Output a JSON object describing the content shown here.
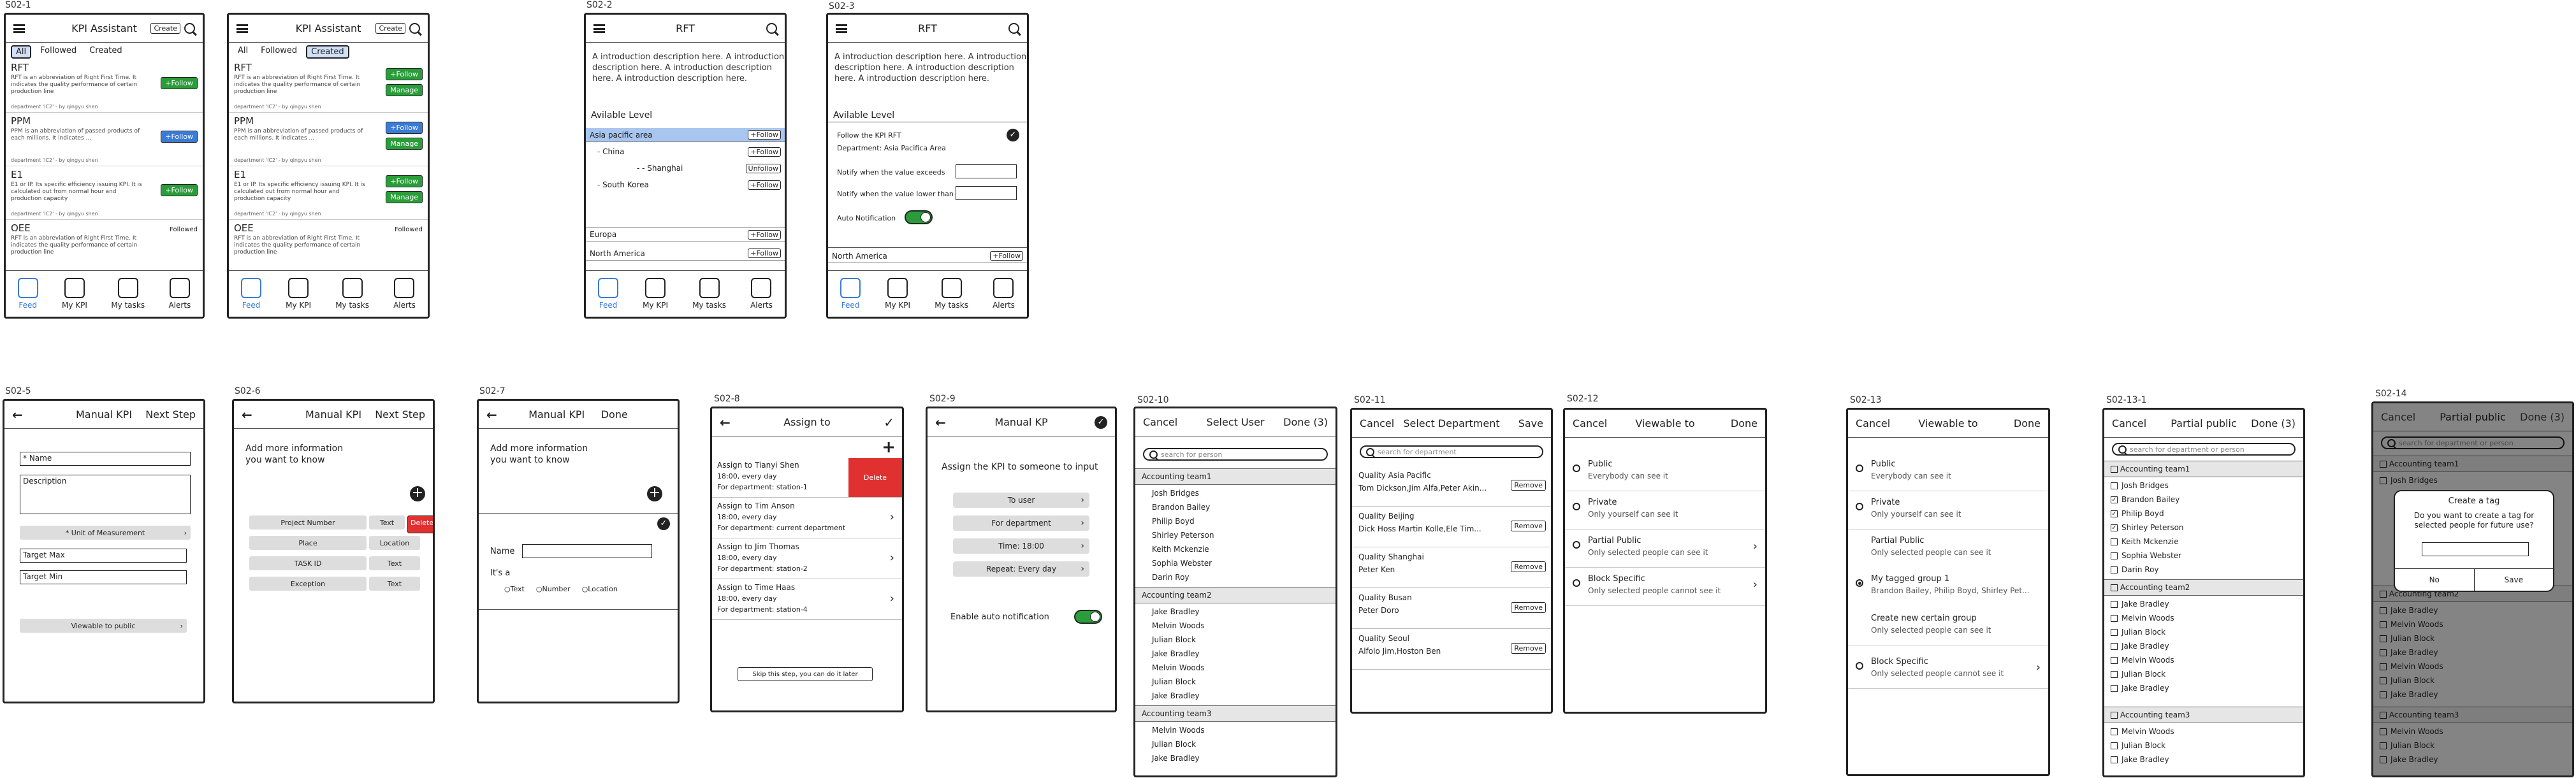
{
  "labels": {
    "s02_1a": "S02-1",
    "s02_2": "S02-2",
    "s02_3": "S02-3",
    "s02_5": "S02-5",
    "s02_6": "S02-6",
    "s02_7": "S02-7",
    "s02_8": "S02-8",
    "s02_9": "S02-9",
    "s02_10": "S02-10",
    "s02_11": "S02-11",
    "s02_12": "S02-12",
    "s02_13": "S02-13",
    "s02_13_1": "S02-13-1",
    "s02_14": "S02-14"
  },
  "kpi": {
    "title": "KPI Assistant",
    "create": "Create",
    "tabs": [
      "All",
      "Followed",
      "Created"
    ],
    "items": [
      {
        "name": "RFT",
        "desc": "RFT is an abbreviation of Right First Time. It indicates the quality performance of certain production line",
        "meta": "department 'IC2' - by qingyu shen"
      },
      {
        "name": "PPM",
        "desc": "PPM is an abbreviation of passed products of each millions. It indicates ...",
        "meta": "department 'IC2' - by qingyu shen"
      },
      {
        "name": "E1",
        "desc": "E1 or IP. Its specific efficiency issuing KPI. It is calculated out from normal hour and production capacity",
        "meta": "department 'IC2' - by qingyu shen"
      },
      {
        "name": "OEE",
        "desc": "RFT is an abbreviation of Right First Time. It indicates the quality performance of certain production line",
        "meta": ""
      }
    ],
    "follow": "+Follow",
    "manage": "Manage",
    "followed": "Followed"
  },
  "tabbar": [
    "Feed",
    "My KPI",
    "My tasks",
    "Alerts"
  ],
  "rft": {
    "title": "RFT",
    "desc": "A introduction description here. A introduction description here. A introduction description here. A introduction description here.",
    "level_title": "Avilable Level",
    "levels": [
      "Asia pacific area",
      "- China",
      "- - Shanghai",
      "- South Korea",
      "Europa",
      "North America"
    ],
    "follow": "+Follow",
    "unfollow": "Unfollow"
  },
  "follow_panel": {
    "title": "Follow the KPI RFT",
    "dept": "Department: Asia Pacifica Area",
    "exceeds": "Notify when the value exceeds",
    "lower": "Notify when the value lower than",
    "auto": "Auto Notification"
  },
  "manual": {
    "title": "Manual KPI",
    "next": "Next Step",
    "done": "Done",
    "name": "* Name",
    "description": "Description",
    "unit": "* Unit of Measurement",
    "target_max": "Target Max",
    "target_min": "Target Min",
    "viewable": "Viewable to public",
    "more_info": "Add more information you want to know",
    "info_rows": [
      [
        "Project Number",
        "Text"
      ],
      [
        "Place",
        "Location"
      ],
      [
        "TASK ID",
        "Text"
      ],
      [
        "Exception",
        "Text"
      ]
    ],
    "delete": "Delete",
    "name_label": "Name",
    "its_a": "It's a",
    "types": [
      "Text",
      "Number",
      "Location"
    ]
  },
  "assign": {
    "title": "Assign to",
    "items": [
      {
        "name": "Assign to Tianyi Shen",
        "time": "18:00, every day",
        "dept": "For department: station-1"
      },
      {
        "name": "Assign to Tim Anson",
        "time": "18:00, every day",
        "dept": "For department: current department"
      },
      {
        "name": "Assign to Jim Thomas",
        "time": "18:00, every day",
        "dept": "For department: station-2"
      },
      {
        "name": "Assign to Time Haas",
        "time": "18:00, every day",
        "dept": "For department: station-4"
      }
    ],
    "delete": "Delete",
    "skip": "Skip this step, you can do it later"
  },
  "s09": {
    "title": "Manual KP",
    "heading": "Assign the KPI to someone to input",
    "options": [
      "To user",
      "For department",
      "Time: 18:00",
      "Repeat: Every day"
    ],
    "auto": "Enable auto notification"
  },
  "select_user": {
    "cancel": "Cancel",
    "title": "Select User",
    "done": "Done (3)",
    "search": "search for person",
    "groups": [
      {
        "name": "Accounting team1",
        "users": [
          "Josh Bridges",
          "Brandon Bailey",
          "Philip Boyd",
          "Shirley Peterson",
          "Keith Mckenzie",
          "Sophia Webster",
          "Darin Roy"
        ]
      },
      {
        "name": "Accounting team2",
        "users": [
          "Jake Bradley",
          "Melvin Woods",
          "Julian Block",
          "Jake Bradley",
          "Melvin Woods",
          "Julian Block",
          "Jake Bradley"
        ]
      },
      {
        "name": "Accounting team3",
        "users": [
          "Melvin Woods",
          "Julian Block",
          "Jake Bradley"
        ]
      }
    ]
  },
  "select_dept": {
    "cancel": "Cancel",
    "title": "Select Department",
    "save": "Save",
    "search": "search for department",
    "remove": "Remove",
    "items": [
      {
        "name": "Quality Asia Pacific",
        "people": "Tom Dickson,Jim Alfa,Peter Akin..."
      },
      {
        "name": "Quality Beijing",
        "people": "Dick Hoss Martin Kolle,Ele Tim..."
      },
      {
        "name": "Quality Shanghai",
        "people": "Peter Ken"
      },
      {
        "name": "Quality Busan",
        "people": "Peter Doro"
      },
      {
        "name": "Quality Seoul",
        "people": "Alfolo Jim,Hoston Ben"
      }
    ]
  },
  "viewable": {
    "cancel": "Cancel",
    "title": "Viewable to",
    "done": "Done",
    "options": [
      {
        "name": "Public",
        "sub": "Everybody can see it"
      },
      {
        "name": "Private",
        "sub": "Only yourself can see it"
      },
      {
        "name": "Partial Public",
        "sub": "Only selected people can see it"
      },
      {
        "name": "Block Specific",
        "sub": "Only selected people cannot see it"
      }
    ],
    "tag_group": "My tagged group 1",
    "tag_people": "Brandon Bailey, Philip Boyd, Shirley Pet...",
    "new_group": "Create new certain group",
    "new_group_sub": "Only selected people can see it"
  },
  "partial": {
    "cancel": "Cancel",
    "title": "Partial public",
    "done": "Done (3)",
    "search": "search for department or person",
    "checked": [
      "Brandon Bailey",
      "Philip Boyd",
      "Shirley Peterson"
    ]
  },
  "dialog": {
    "title": "Create a tag",
    "text": "Do you want to create a tag for selected people for future use?",
    "no": "No",
    "save": "Save"
  },
  "colors": {
    "green": "#2a9d3a",
    "blue": "#3a7bd5",
    "red": "#e03030",
    "highlight": "#a9c6f0"
  }
}
